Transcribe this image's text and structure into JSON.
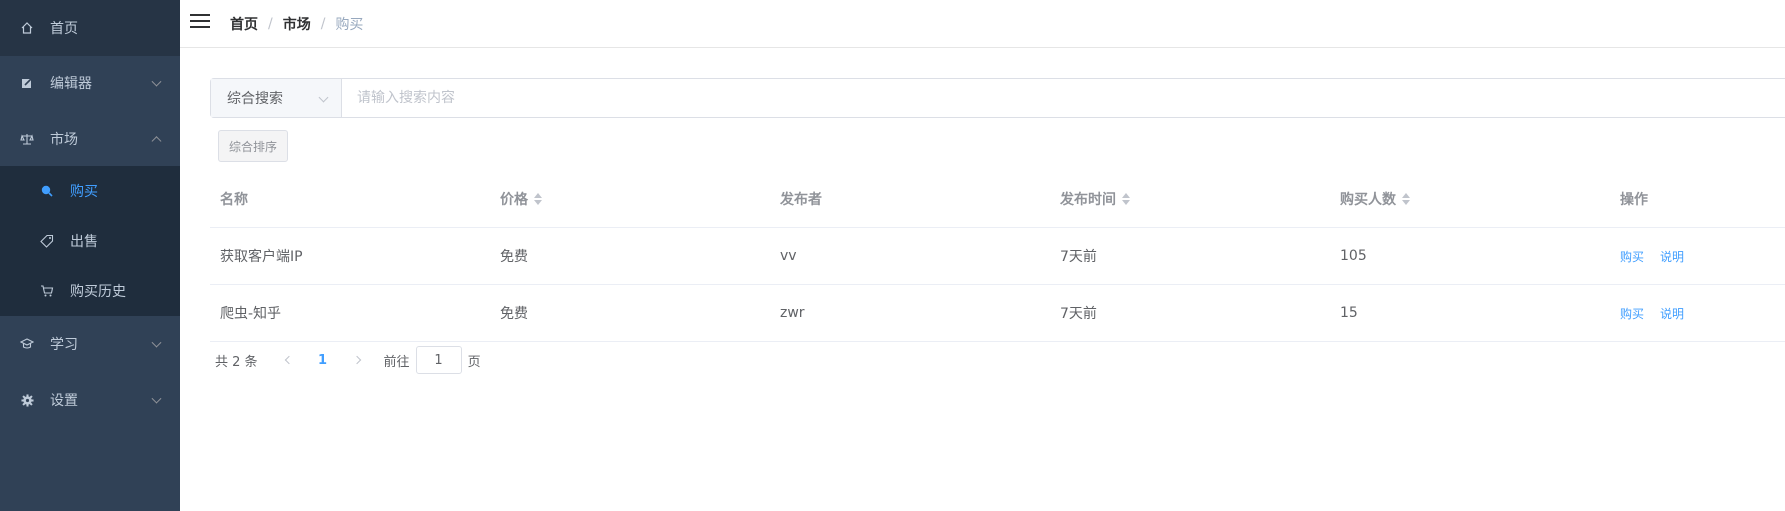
{
  "sidebar": {
    "home": "首页",
    "editor": "编辑器",
    "market": "市场",
    "market_sub": {
      "buy": "购买",
      "sell": "出售",
      "history": "购买历史"
    },
    "learn": "学习",
    "settings": "设置"
  },
  "breadcrumb": {
    "items": [
      "首页",
      "市场",
      "购买"
    ],
    "separator": "/"
  },
  "search": {
    "select_value": "综合搜索",
    "placeholder": "请输入搜索内容",
    "value": ""
  },
  "sort_button": "综合排序",
  "table": {
    "headers": [
      "名称",
      "价格",
      "发布者",
      "发布时间",
      "购买人数",
      "操作"
    ],
    "rows": [
      {
        "name": "获取客户端IP",
        "price": "免费",
        "publisher": "vv",
        "time": "7天前",
        "buyers": "105",
        "op_buy": "购买",
        "op_desc": "说明"
      },
      {
        "name": "爬虫-知乎",
        "price": "免费",
        "publisher": "zwr",
        "time": "7天前",
        "buyers": "15",
        "op_buy": "购买",
        "op_desc": "说明"
      }
    ]
  },
  "pagination": {
    "total": "共 2 条",
    "current_page": "1",
    "goto_label": "前往",
    "goto_value": "1",
    "page_suffix": "页"
  },
  "colors": {
    "sidebar_bg": "#304156",
    "submenu_bg": "#1f2d3d",
    "accent": "#409eff"
  }
}
